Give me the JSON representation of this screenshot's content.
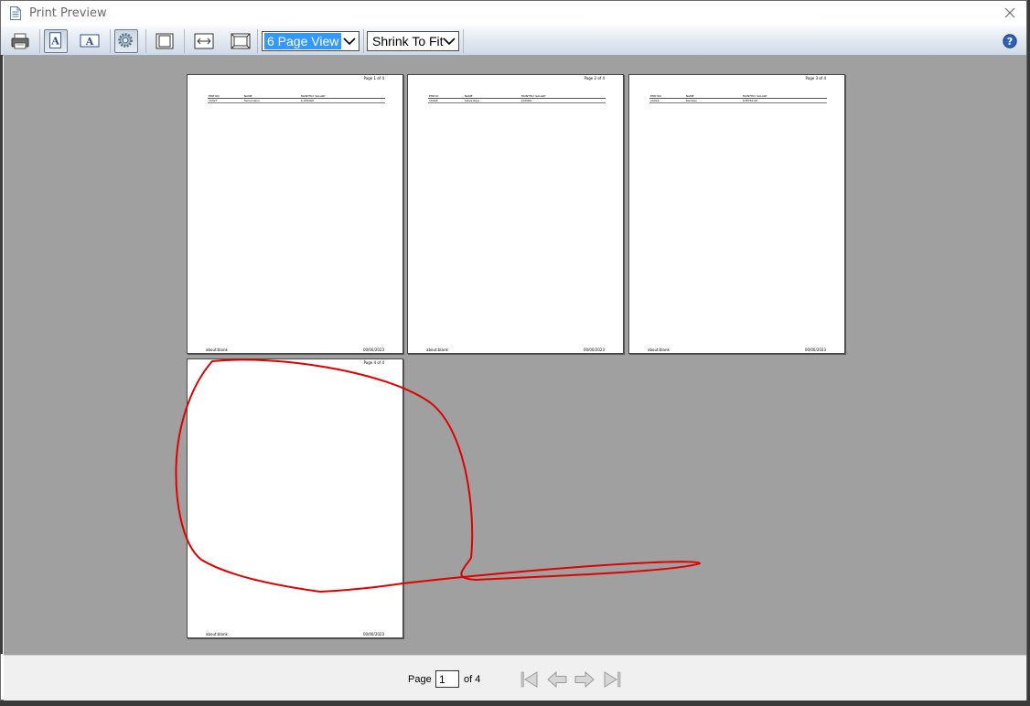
{
  "window": {
    "title": "Print Preview"
  },
  "toolbar": {
    "view_select": {
      "value": "6 Page View"
    },
    "scale_select": {
      "value": "Shrink To Fit"
    },
    "buttons": [
      "print-icon",
      "portrait-icon",
      "landscape-icon",
      "page-setup-icon",
      "single-page-icon",
      "fit-width-icon",
      "fit-page-icon",
      "help-icon"
    ]
  },
  "pages": [
    {
      "page_label": "Page 1 of 4",
      "table": {
        "headers": [
          "EMP NO",
          "NAME",
          "MONTHLY SALARY"
        ],
        "rows": [
          [
            "10027",
            "Tamundson",
            "$ 455000"
          ]
        ]
      },
      "footer_left": "about:blank",
      "footer_right": "00/00/2023"
    },
    {
      "page_label": "Page 2 of 4",
      "table": {
        "headers": [
          "EMP ID",
          "NAME",
          "MONTHLY SALARY"
        ],
        "rows": [
          [
            "10093",
            "Satva Raja",
            "$40000"
          ]
        ]
      },
      "footer_left": "about:blank",
      "footer_right": "00/00/2023"
    },
    {
      "page_label": "Page 3 of 4",
      "table": {
        "headers": [
          "EMP NO",
          "NAME",
          "MONTHLY SALARY"
        ],
        "rows": [
          [
            "10016",
            "Ramkan",
            "$38750.00"
          ]
        ]
      },
      "footer_left": "about:blank",
      "footer_right": "00/00/2023"
    },
    {
      "page_label": "Page 4 of 4",
      "footer_left": "about:blank",
      "footer_right": "00/00/2023"
    }
  ],
  "status": {
    "page_label": "Page",
    "current_page": "1",
    "total_label": "of 4"
  },
  "colors": {
    "preview_bg": "#a0a0a0",
    "annotation": "#e00000",
    "selection": "#3399ff"
  }
}
